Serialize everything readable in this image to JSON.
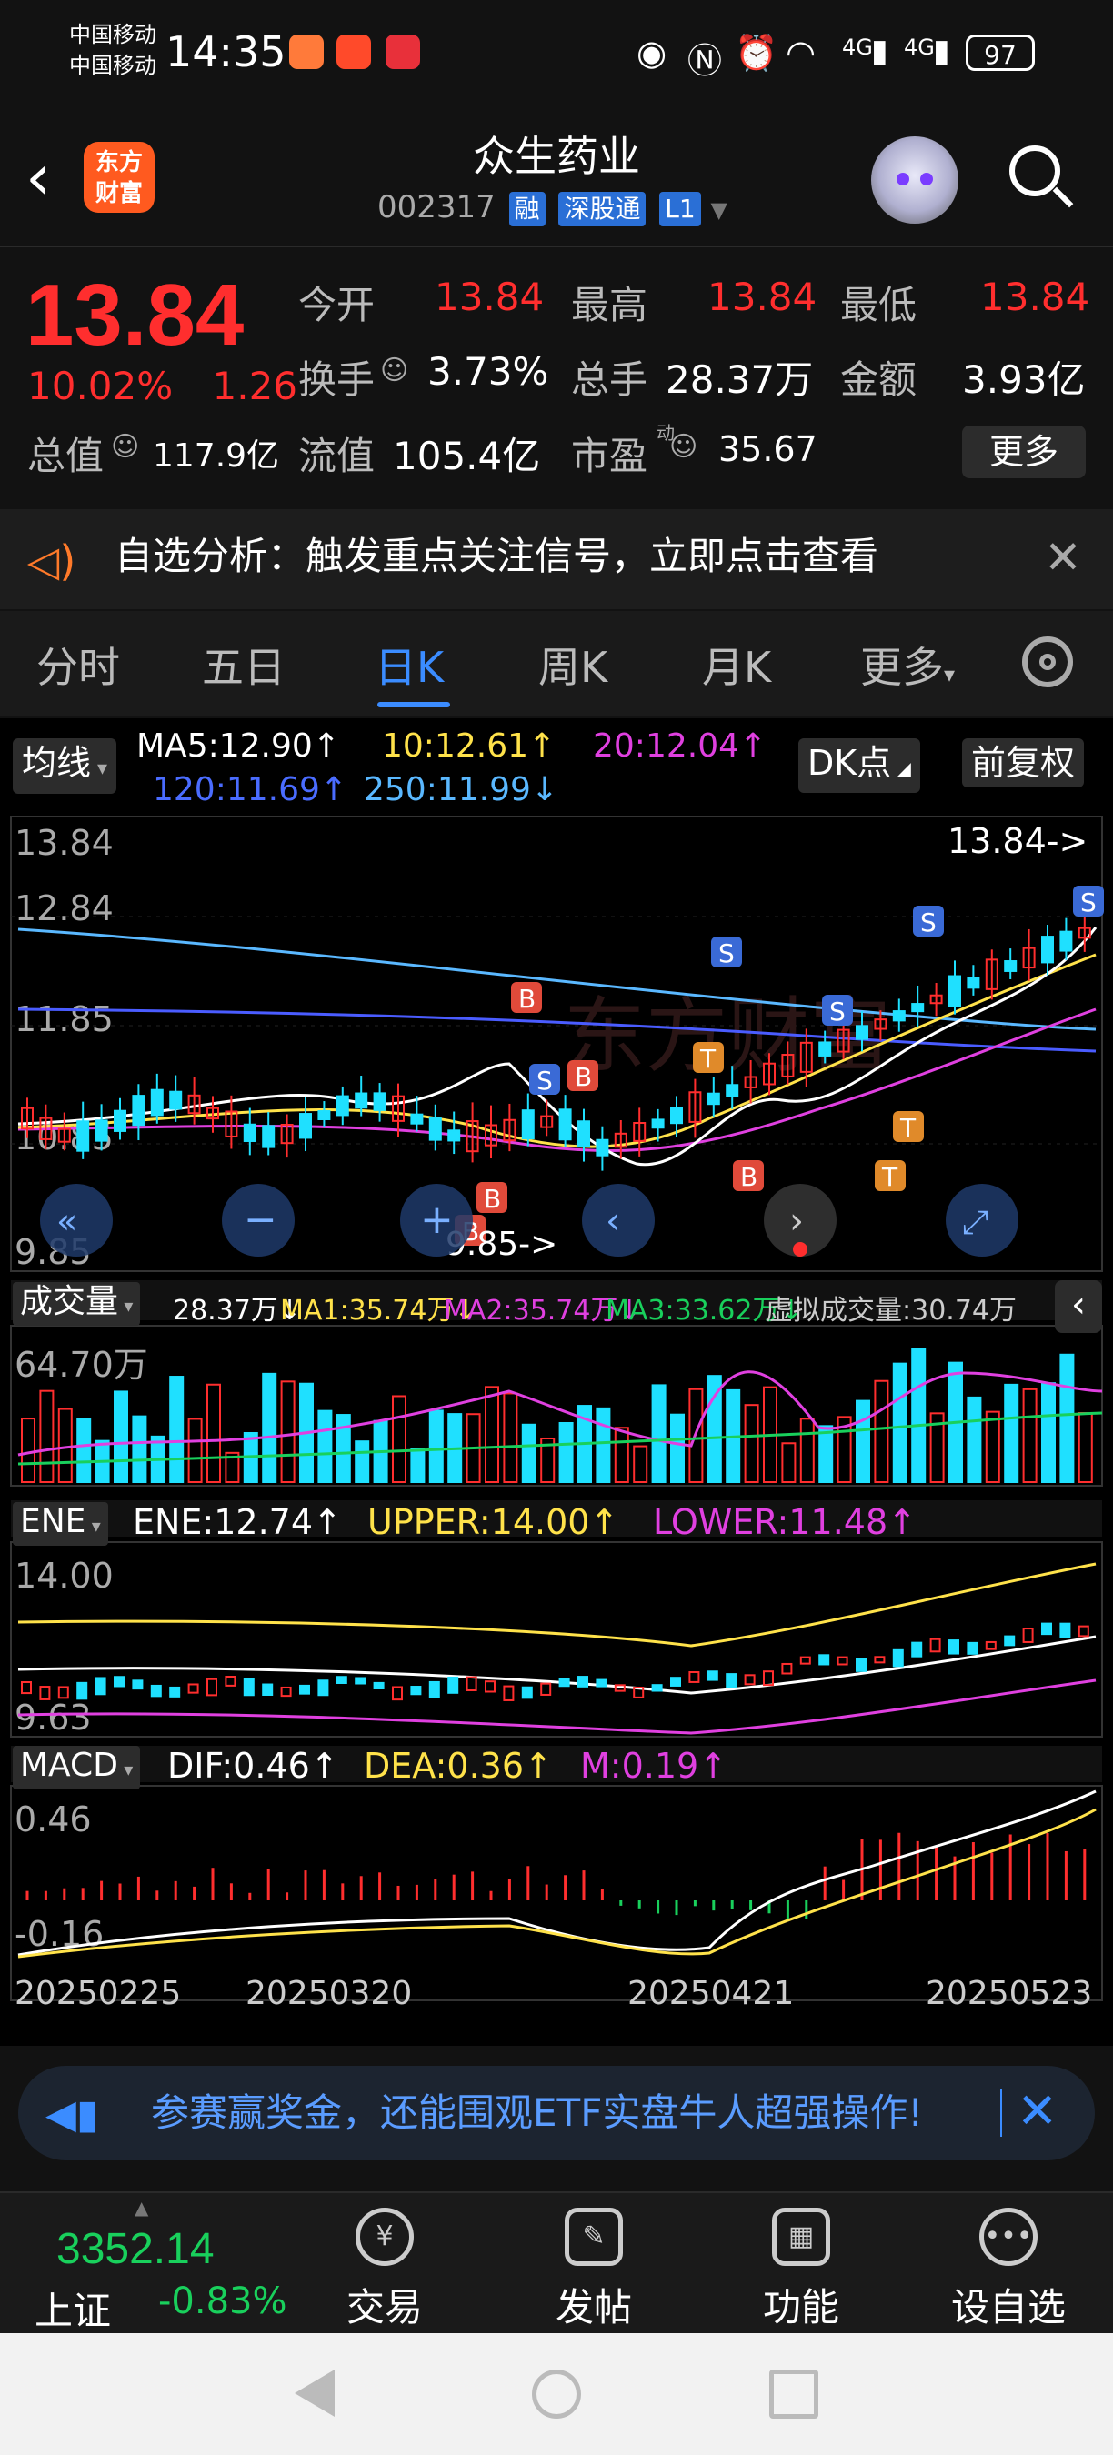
{
  "status": {
    "carrier1": "中国移动",
    "carrier2": "中国移动",
    "time": "14:35",
    "battery": "97",
    "signal1": "4G",
    "signal2": "4G"
  },
  "header": {
    "logo_line1": "东方",
    "logo_line2": "财富",
    "title": "众生药业",
    "code": "002317",
    "tags": [
      "融",
      "深股通",
      "L1"
    ]
  },
  "quote": {
    "price": "13.84",
    "change_pct": "10.02%",
    "change_amt": "1.26",
    "open_label": "今开",
    "open": "13.84",
    "high_label": "最高",
    "high": "13.84",
    "low_label": "最低",
    "low": "13.84",
    "turnover_label": "换手",
    "turnover": "3.73%",
    "volume_label": "总手",
    "volume": "28.37万",
    "amount_label": "金额",
    "amount": "3.93亿",
    "mktcap_label": "总值",
    "mktcap": "117.9亿",
    "float_label": "流值",
    "float": "105.4亿",
    "pe_label": "市盈",
    "pe_sup": "动",
    "pe": "35.67",
    "more": "更多"
  },
  "notice": {
    "text": "自选分析：触发重点关注信号，立即点击查看"
  },
  "tabs": [
    "分时",
    "五日",
    "日K",
    "周K",
    "月K",
    "更多"
  ],
  "chart": {
    "ma_selector": "均线",
    "ma5": "MA5:12.90↑",
    "ma10": "10:12.61↑",
    "ma20": "20:12.04↑",
    "ma120": "120:11.69↑",
    "ma250": "250:11.99↓",
    "dk_button": "DK点",
    "adjust_button": "前复权",
    "price_ticks": [
      "13.84",
      "12.84",
      "11.85",
      "10.85",
      "9.85"
    ],
    "last_price_label": "13.84->",
    "low_label": "9.85->",
    "vol_selector": "成交量",
    "vol_now": "28.37万↓",
    "vol_ma1": "MA1:35.74万↓",
    "vol_ma2": "MA2:35.74万↓",
    "vol_ma3": "MA3:33.62万↓",
    "vol_virtual": "虚拟成交量:30.74万",
    "vol_max": "64.70万",
    "ene_selector": "ENE",
    "ene": "ENE:12.74↑",
    "ene_upper": "UPPER:14.00↑",
    "ene_lower": "LOWER:11.48↑",
    "ene_top": "14.00",
    "ene_bottom": "9.63",
    "macd_selector": "MACD",
    "dif": "DIF:0.46↑",
    "dea": "DEA:0.36↑",
    "macd_m": "M:0.19↑",
    "macd_top": "0.46",
    "macd_bottom": "-0.16",
    "dates": [
      "20250225",
      "20250320",
      "20250421",
      "20250523"
    ]
  },
  "ad": {
    "text": "参赛赢奖金，还能围观ETF实盘牛人超强操作!"
  },
  "bottom": {
    "index_value": "3352.14",
    "index_name": "上证",
    "index_change": "-0.83%",
    "nav": [
      "交易",
      "发帖",
      "功能",
      "设自选"
    ]
  },
  "colors": {
    "up": "#ff2e2e",
    "down": "#19d05c",
    "accent": "#3b8cff",
    "ma5": "#ffffff",
    "ma10": "#ffe24a",
    "ma20": "#e040e0"
  }
}
